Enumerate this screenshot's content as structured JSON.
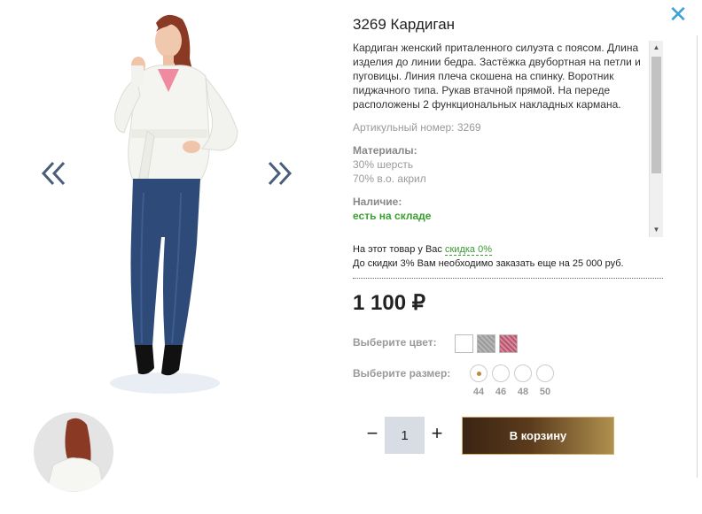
{
  "product": {
    "title": "3269 Кардиган",
    "description": "Кардиган женский приталенного силуэта с поясом. Длина изделия до линии бедра. Застёжка двубортная на петли и пуговицы. Линия плеча скошена на спинку. Воротник пиджачного типа. Рукав втачной прямой. На переде расположены 2 функциональных накладных кармана.",
    "sku_text": "Артикульный номер: 3269",
    "materials_label": "Материалы:",
    "materials": [
      "30% шерсть",
      "70% в.о. акрил"
    ],
    "stock_label": "Наличие:",
    "stock_value": "есть на складе",
    "price": "1 100",
    "currency": "₽"
  },
  "discount": {
    "line1_prefix": "На этот товар у Вас ",
    "line1_link": "скидка 0%",
    "line2": "До скидки 3% Вам необходимо заказать еще на 25 000 руб."
  },
  "color": {
    "label": "Выберите цвет:",
    "swatches": [
      "белый",
      "серый",
      "розовый"
    ]
  },
  "size": {
    "label": "Выберите размер:",
    "options": [
      "44",
      "46",
      "48",
      "50"
    ],
    "selected": "44"
  },
  "cart": {
    "quantity": "1",
    "minus": "−",
    "plus": "+",
    "button_label": "В корзину"
  },
  "ui": {
    "close_icon": "close-icon",
    "prev_icon": "double-chevron-left-icon",
    "next_icon": "double-chevron-right-icon",
    "accent": "#3aa0d8",
    "stock_color": "#3aa130"
  }
}
